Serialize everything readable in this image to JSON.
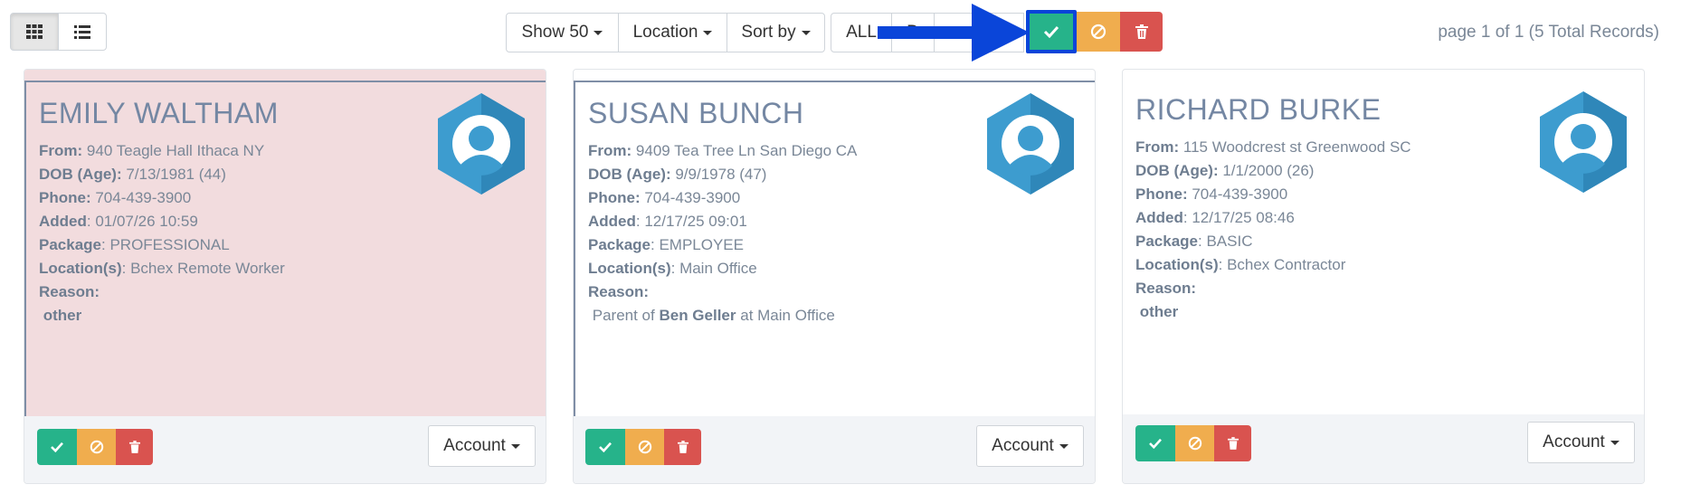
{
  "toolbar": {
    "views": [
      {
        "icon": "grid-icon"
      },
      {
        "icon": "list-icon"
      }
    ],
    "show": "Show 50",
    "location": "Location",
    "sort": "Sort by",
    "filters": [
      "ALL",
      "D",
      "T"
    ],
    "approve_icon": "check-icon",
    "reject_icon": "ban-icon",
    "delete_icon": "trash-icon"
  },
  "paging": "page 1 of 1 (5 Total Records)",
  "labels": {
    "from": "From:",
    "dob": "DOB (Age):",
    "phone": "Phone:",
    "added": "Added",
    "package": "Package",
    "locations": "Location(s)",
    "reason": "Reason:",
    "account": "Account"
  },
  "cards": [
    {
      "name": "EMILY WALTHAM",
      "from": "940 Teagle Hall Ithaca NY",
      "dob": "7/13/1981 (44)",
      "phone": "704-439-3900",
      "added": "01/07/26 10:59",
      "package": "PROFESSIONAL",
      "locations": "Bchex Remote Worker",
      "reason": "other"
    },
    {
      "name": "SUSAN BUNCH",
      "from": "9409 Tea Tree Ln San Diego CA",
      "dob": "9/9/1978 (47)",
      "phone": "704-439-3900",
      "added": "12/17/25 09:01",
      "package": "EMPLOYEE",
      "locations": "Main Office",
      "reason_prefix": "Parent of",
      "reason_name": "Ben Geller",
      "reason_suffix": "at Main Office"
    },
    {
      "name": "RICHARD BURKE",
      "from": "115 Woodcrest st Greenwood SC",
      "dob": "1/1/2000 (26)",
      "phone": "704-439-3900",
      "added": "12/17/25 08:46",
      "package": "BASIC",
      "locations": "Bchex Contractor",
      "reason": "other"
    }
  ],
  "colors": {
    "approve": "#26b38a",
    "reject": "#f0ad4e",
    "delete": "#d9534f",
    "highlight": "#0a45d9",
    "avatar": "#3d9ccf"
  }
}
